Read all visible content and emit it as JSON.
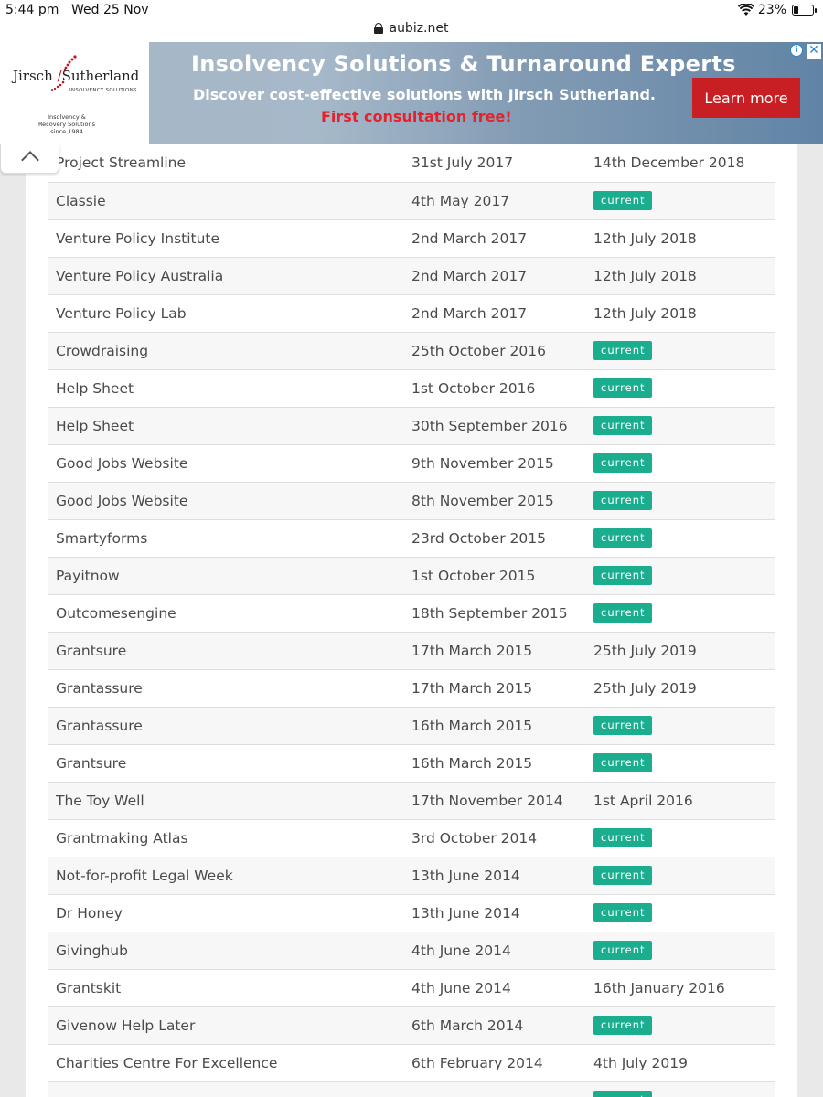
{
  "status_bar": {
    "time": "5:44 pm",
    "date": "Wed 25 Nov",
    "battery_percent": "23%",
    "battery_level": 0.23
  },
  "browser": {
    "url": "aubiz.net"
  },
  "ad": {
    "brand_first": "Jirsch",
    "brand_second": "Sutherland",
    "brand_sub": "INSOLVENCY SOLUTIONS",
    "brand_tagline": "Insolvency & Recovery Solutions since 1984",
    "headline": "Insolvency Solutions & Turnaround Experts",
    "subline": "Discover cost-effective solutions with Jirsch Sutherland.",
    "offer": "First consultation free!",
    "cta": "Learn more",
    "adchoices": "i",
    "close": "✕"
  },
  "table": {
    "rows": [
      {
        "name": "Project Streamline",
        "start": "31st July 2017",
        "end": "14th December 2018",
        "current": false
      },
      {
        "name": "Classie",
        "start": "4th May 2017",
        "end": "current",
        "current": true
      },
      {
        "name": "Venture Policy Institute",
        "start": "2nd March 2017",
        "end": "12th July 2018",
        "current": false
      },
      {
        "name": "Venture Policy Australia",
        "start": "2nd March 2017",
        "end": "12th July 2018",
        "current": false
      },
      {
        "name": "Venture Policy Lab",
        "start": "2nd March 2017",
        "end": "12th July 2018",
        "current": false
      },
      {
        "name": "Crowdraising",
        "start": "25th October 2016",
        "end": "current",
        "current": true
      },
      {
        "name": "Help Sheet",
        "start": "1st October 2016",
        "end": "current",
        "current": true
      },
      {
        "name": "Help Sheet",
        "start": "30th September 2016",
        "end": "current",
        "current": true
      },
      {
        "name": "Good Jobs Website",
        "start": "9th November 2015",
        "end": "current",
        "current": true
      },
      {
        "name": "Good Jobs Website",
        "start": "8th November 2015",
        "end": "current",
        "current": true
      },
      {
        "name": "Smartyforms",
        "start": "23rd October 2015",
        "end": "current",
        "current": true
      },
      {
        "name": "Payitnow",
        "start": "1st October 2015",
        "end": "current",
        "current": true
      },
      {
        "name": "Outcomesengine",
        "start": "18th September 2015",
        "end": "current",
        "current": true
      },
      {
        "name": "Grantsure",
        "start": "17th March 2015",
        "end": "25th July 2019",
        "current": false
      },
      {
        "name": "Grantassure",
        "start": "17th March 2015",
        "end": "25th July 2019",
        "current": false
      },
      {
        "name": "Grantassure",
        "start": "16th March 2015",
        "end": "current",
        "current": true
      },
      {
        "name": "Grantsure",
        "start": "16th March 2015",
        "end": "current",
        "current": true
      },
      {
        "name": "The Toy Well",
        "start": "17th November 2014",
        "end": "1st April 2016",
        "current": false
      },
      {
        "name": "Grantmaking Atlas",
        "start": "3rd October 2014",
        "end": "current",
        "current": true
      },
      {
        "name": "Not-for-profit Legal Week",
        "start": "13th June 2014",
        "end": "current",
        "current": true
      },
      {
        "name": "Dr Honey",
        "start": "13th June 2014",
        "end": "current",
        "current": true
      },
      {
        "name": "Givinghub",
        "start": "4th June 2014",
        "end": "current",
        "current": true
      },
      {
        "name": "Grantskit",
        "start": "4th June 2014",
        "end": "16th January 2016",
        "current": false
      },
      {
        "name": "Givenow Help Later",
        "start": "6th March 2014",
        "end": "current",
        "current": true
      },
      {
        "name": "Charities Centre For Excellence",
        "start": "6th February 2014",
        "end": "4th July 2019",
        "current": false
      },
      {
        "name": "",
        "start": "",
        "end": "current",
        "current": true
      }
    ]
  }
}
